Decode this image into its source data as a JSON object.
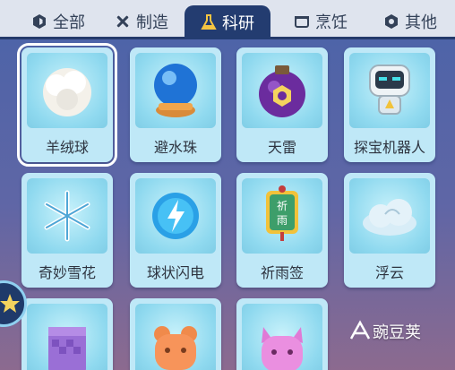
{
  "tabs": [
    {
      "label": "全部",
      "icon": "hexagon-icon"
    },
    {
      "label": "制造",
      "icon": "tools-icon"
    },
    {
      "label": "科研",
      "icon": "flask-icon",
      "active": true
    },
    {
      "label": "烹饪",
      "icon": "pot-icon"
    },
    {
      "label": "其他",
      "icon": "gear-cube-icon"
    }
  ],
  "items": [
    {
      "label": "羊绒球",
      "icon": "wool-ball-icon",
      "selected": true
    },
    {
      "label": "避水珠",
      "icon": "crystal-ball-icon"
    },
    {
      "label": "天雷",
      "icon": "purple-bomb-icon"
    },
    {
      "label": "探宝机器人",
      "icon": "robot-icon"
    },
    {
      "label": "奇妙雪花",
      "icon": "snowflake-icon"
    },
    {
      "label": "球状闪电",
      "icon": "lightning-orb-icon"
    },
    {
      "label": "祈雨签",
      "icon": "rain-tag-icon",
      "tag_text": "祈雨"
    },
    {
      "label": "浮云",
      "icon": "cloud-icon"
    },
    {
      "label": "",
      "icon": "purple-cloth-icon"
    },
    {
      "label": "",
      "icon": "orange-bear-jelly-icon"
    },
    {
      "label": "",
      "icon": "pink-cat-jelly-icon"
    }
  ],
  "watermark": {
    "text": "豌豆荚"
  },
  "colors": {
    "tab_active_bg": "#233c70",
    "tab_bar_bg": "#dfe4ee",
    "card_bg": "#bfe8f7",
    "page_top": "#4a63a8"
  }
}
